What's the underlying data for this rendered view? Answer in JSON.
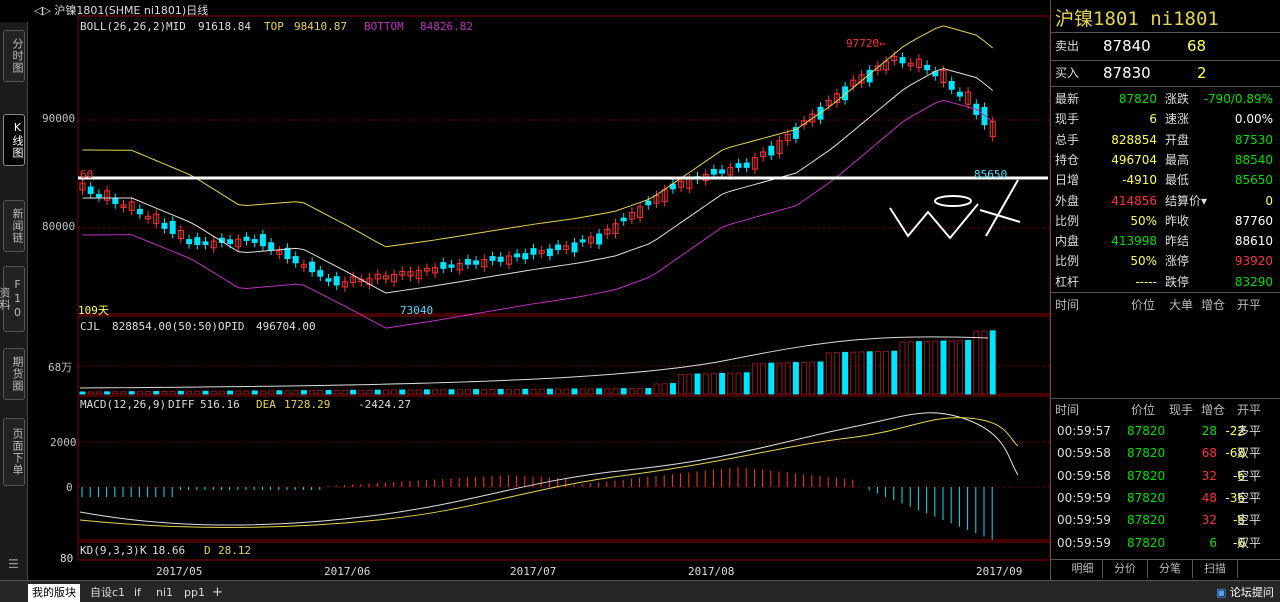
{
  "window_title": "沪镍1801(SHME ni1801)日线",
  "left_tabs": [
    "分时图",
    "K线图",
    "新闻链",
    "F10资料",
    "期货圈",
    "页面下单"
  ],
  "boll": {
    "label": "BOLL(26,26,2)",
    "mid_label": "MID",
    "mid": "91618.84",
    "top_label": "TOP",
    "top": "98410.87",
    "bottom_label": "BOTTOM",
    "bottom": "84826.82"
  },
  "price_axis": [
    "90000",
    "80000"
  ],
  "annotations": {
    "high": "97720←",
    "low": "73040",
    "mark": "85650",
    "days": "109天",
    "left_mark": "60"
  },
  "cjl": {
    "label": "CJL",
    "value": "828854.00(50:50)",
    "opid_label": "OPID",
    "opid": "496704.00",
    "axis": "68万"
  },
  "macd": {
    "label": "MACD(12,26,9)",
    "diff_label": "DIFF",
    "diff": "516.16",
    "dea_label": "DEA",
    "dea": "1728.29",
    "macd": "-2424.27",
    "axis": [
      "2000",
      "0"
    ]
  },
  "kd": {
    "label": "KD(9,3,3)",
    "k_label": "K",
    "k": "18.66",
    "d_label": "D",
    "d": "28.12",
    "axis": "80"
  },
  "dates": [
    "2017/05",
    "2017/06",
    "2017/07",
    "2017/08",
    "2017/09"
  ],
  "quote": {
    "title": "沪镍1801 ni1801",
    "sell": {
      "label": "卖出",
      "price": "87840",
      "vol": "68"
    },
    "buy": {
      "label": "买入",
      "price": "87830",
      "vol": "2"
    },
    "rows": [
      {
        "l1": "最新",
        "v1": "87820",
        "c1": "green",
        "l2": "涨跌",
        "v2": "-790/0.89%",
        "c2": "green"
      },
      {
        "l1": "现手",
        "v1": "6",
        "c1": "yellow",
        "l2": "速涨",
        "v2": "0.00%",
        "c2": "white"
      },
      {
        "l1": "总手",
        "v1": "828854",
        "c1": "yellow",
        "l2": "开盘",
        "v2": "87530",
        "c2": "green"
      },
      {
        "l1": "持仓",
        "v1": "496704",
        "c1": "yellow",
        "l2": "最高",
        "v2": "88540",
        "c2": "green"
      },
      {
        "l1": "日增",
        "v1": "-4910",
        "c1": "yellow",
        "l2": "最低",
        "v2": "85650",
        "c2": "green"
      },
      {
        "l1": "外盘",
        "v1": "414856",
        "c1": "red",
        "l2": "结算价▾",
        "v2": "0",
        "c2": "yellow"
      },
      {
        "l1": "比例",
        "v1": "50%",
        "c1": "yellow",
        "l2": "昨收",
        "v2": "87760",
        "c2": "white"
      },
      {
        "l1": "内盘",
        "v1": "413998",
        "c1": "green",
        "l2": "昨结",
        "v2": "88610",
        "c2": "white"
      },
      {
        "l1": "比例",
        "v1": "50%",
        "c1": "yellow",
        "l2": "涨停",
        "v2": "93920",
        "c2": "red"
      },
      {
        "l1": "杠杆",
        "v1": "-----",
        "c1": "yellow",
        "l2": "跌停",
        "v2": "83290",
        "c2": "green"
      }
    ],
    "deal_header": [
      "时间",
      "价位",
      "大单",
      "增仓",
      "开平"
    ],
    "tick_header": [
      "时间",
      "价位",
      "现手",
      "增仓",
      "开平"
    ],
    "ticks": [
      {
        "time": "00:59:57",
        "price": "87820",
        "vol": "28",
        "vcol": "green",
        "inc": "-22",
        "type": "多平"
      },
      {
        "time": "00:59:58",
        "price": "87820",
        "vol": "68",
        "vcol": "red",
        "inc": "-68",
        "type": "双平"
      },
      {
        "time": "00:59:58",
        "price": "87820",
        "vol": "32",
        "vcol": "red",
        "inc": "-6",
        "type": "空平"
      },
      {
        "time": "00:59:59",
        "price": "87820",
        "vol": "48",
        "vcol": "red",
        "inc": "-36",
        "type": "空平"
      },
      {
        "time": "00:59:59",
        "price": "87820",
        "vol": "32",
        "vcol": "red",
        "inc": "-8",
        "type": "空平"
      },
      {
        "time": "00:59:59",
        "price": "87820",
        "vol": "6",
        "vcol": "green",
        "inc": "-6",
        "type": "双平"
      }
    ],
    "bottom_tabs": [
      "明细",
      "分价",
      "分笔",
      "扫描"
    ]
  },
  "bottom_tabs": [
    "我的版块",
    "自设c1",
    "if",
    "ni1",
    "pp1",
    "+"
  ],
  "forum_button": "论坛提问",
  "colors": {
    "up": "#ff3232",
    "down": "#00e5ff",
    "boll_mid": "#e0e0e0",
    "boll_top": "#e6d34c",
    "boll_bottom": "#c030c0"
  }
}
